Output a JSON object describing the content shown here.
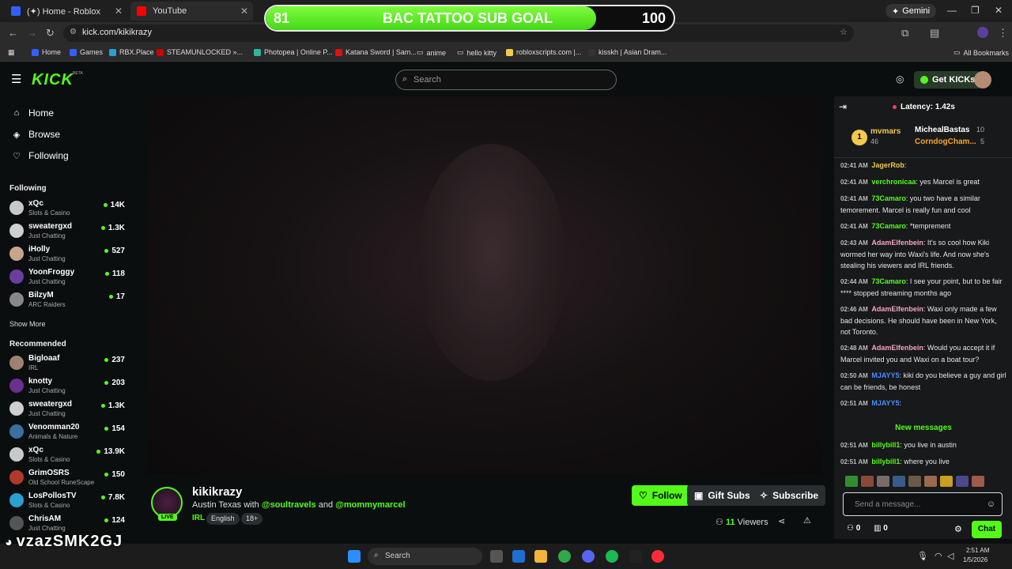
{
  "browser": {
    "tabs": [
      {
        "label": "(✦) Home - Roblox",
        "color": "#335fff"
      },
      {
        "label": "YouTube",
        "color": "#ff0000"
      }
    ],
    "gemini": "Gemini",
    "url": "kick.com/kikikrazy",
    "bookmarks": [
      "Home",
      "Games",
      "RBX.Place",
      "STEAMUNLOCKED »...",
      "Photopea | Online P...",
      "Katana Sword | Sam...",
      "anime",
      "hello kitty",
      "robloxscripts.com |...",
      "kisskh | Asian Dram..."
    ],
    "all_bookmarks": "All Bookmarks"
  },
  "goal": {
    "current": "81",
    "label": "BAC TATTOO SUB GOAL",
    "target": "100",
    "progress": 0.81
  },
  "header": {
    "logo": "KICK",
    "beta": "BETA",
    "search_placeholder": "Search",
    "get_kicks": "Get KICKs"
  },
  "sidebar": {
    "nav": [
      {
        "label": "Home",
        "icon": "home-icon"
      },
      {
        "label": "Browse",
        "icon": "compass-icon"
      },
      {
        "label": "Following",
        "icon": "heart-icon"
      }
    ],
    "following_title": "Following",
    "following": [
      {
        "name": "xQc",
        "cat": "Slots & Casino",
        "viewers": "14K",
        "color": "#c9c9c9"
      },
      {
        "name": "sweatergxd",
        "cat": "Just Chatting",
        "viewers": "1.3K",
        "color": "#cfcfcf"
      },
      {
        "name": "iHolly",
        "cat": "Just Chatting",
        "viewers": "527",
        "color": "#c9a38b"
      },
      {
        "name": "YoonFroggy",
        "cat": "Just Chatting",
        "viewers": "118",
        "color": "#6a3ea0"
      },
      {
        "name": "BilzyM",
        "cat": "ARC Raiders",
        "viewers": "17",
        "color": "#888"
      }
    ],
    "show_more": "Show More",
    "recommended_title": "Recommended",
    "recommended": [
      {
        "name": "Bigloaaf",
        "cat": "IRL",
        "viewers": "237",
        "color": "#a08070"
      },
      {
        "name": "knotty",
        "cat": "Just Chatting",
        "viewers": "203",
        "color": "#6a2f8f"
      },
      {
        "name": "sweatergxd",
        "cat": "Just Chatting",
        "viewers": "1.3K",
        "color": "#cfcfcf"
      },
      {
        "name": "Venomman20",
        "cat": "Animals & Nature",
        "viewers": "154",
        "color": "#3a6fa0"
      },
      {
        "name": "xQc",
        "cat": "Slots & Casino",
        "viewers": "13.9K",
        "color": "#c9c9c9"
      },
      {
        "name": "GrimOSRS",
        "cat": "Old School RuneScape",
        "viewers": "150",
        "color": "#b03a2a"
      },
      {
        "name": "LosPollosTV",
        "cat": "Slots & Casino",
        "viewers": "7.8K",
        "color": "#2aa0d0"
      },
      {
        "name": "ChrisAM",
        "cat": "Just Chatting",
        "viewers": "124",
        "color": "#555"
      }
    ]
  },
  "stream": {
    "channel": "kikikrazy",
    "live": "LIVE",
    "title_pre": "Austin Texas with",
    "with1": "@soultravels",
    "and": "and",
    "with2": "@mommymarcel",
    "tags": [
      "IRL",
      "English",
      "18+"
    ],
    "follow": "Follow",
    "gift": "Gift Subs",
    "subscribe": "Subscribe",
    "viewers": "11",
    "viewers_label": "Viewers"
  },
  "chat": {
    "latency": "Latency: 1.42s",
    "leaders": [
      {
        "name": "mvmars",
        "score": "46",
        "color": "#f2c94c"
      },
      {
        "name": "MichealBastas",
        "score": "10",
        "color": "#fff"
      },
      {
        "name": "CorndogCham...",
        "score": "5",
        "color": "#f5a623"
      }
    ],
    "rank": "1",
    "messages": [
      {
        "time": "02:41 AM",
        "user": "JagerRob",
        "color": "#f2c94c",
        "text": ""
      },
      {
        "time": "02:41 AM",
        "user": "verchronicaa",
        "color": "#53fc18",
        "text": "yes Marcel is great"
      },
      {
        "time": "02:41 AM",
        "user": "73Camaro",
        "color": "#53fc18",
        "text": "you two have a similar temorement. Marcel is really fun and cool"
      },
      {
        "time": "02:41 AM",
        "user": "73Camaro",
        "color": "#53fc18",
        "text": "*temprement"
      },
      {
        "time": "02:43 AM",
        "user": "AdamElfenbein",
        "color": "#f4a4c0",
        "text": "It's so cool how Kiki wormed her way into Waxi's life. And now she's stealing his viewers and IRL friends."
      },
      {
        "time": "02:44 AM",
        "user": "73Camaro",
        "color": "#53fc18",
        "text": "I see your point, but to be fair **** stopped streaming months ago"
      },
      {
        "time": "02:46 AM",
        "user": "AdamElfenbein",
        "color": "#f4a4c0",
        "text": "Waxi only made a few bad decisions. He should have been in New York, not Toronto."
      },
      {
        "time": "02:48 AM",
        "user": "AdamElfenbein",
        "color": "#f4a4c0",
        "text": "Would you accept it if Marcel invited you and Waxi on a boat tour?"
      },
      {
        "time": "02:50 AM",
        "user": "MJAYY5",
        "color": "#4a8cff",
        "text": "kiki do you believe a guy and girl can be friends, be honest"
      },
      {
        "time": "02:51 AM",
        "user": "MJAYY5",
        "color": "#4a8cff",
        "text": ""
      }
    ],
    "new_messages": "New messages",
    "new": [
      {
        "time": "02:51 AM",
        "user": "billybill1",
        "color": "#53fc18",
        "text": "you live in austin"
      },
      {
        "time": "02:51 AM",
        "user": "billybill1",
        "color": "#53fc18",
        "text": "where you live"
      }
    ],
    "placeholder": "Send a message...",
    "count1": "0",
    "count2": "0",
    "chat_button": "Chat"
  },
  "taskbar": {
    "search": "Search",
    "time": "2:51 AM",
    "date": "1/5/2026"
  },
  "watermark": "vzazSMK2GJ"
}
